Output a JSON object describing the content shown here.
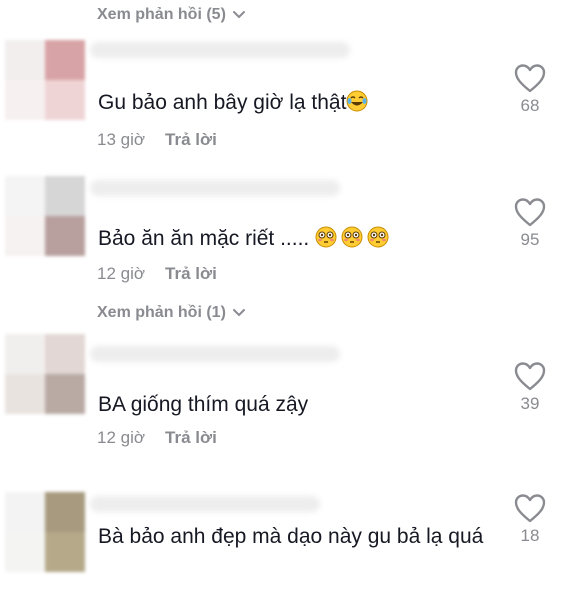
{
  "thread1": {
    "view_replies": "Xem phản hồi (5)"
  },
  "comments": [
    {
      "text": "Gu bảo anh bây giờ lạ thật",
      "emoji": "laughing-crying-emoji",
      "time": "13 giờ",
      "reply": "Trả lời",
      "likes": "68"
    },
    {
      "text": "Bảo ăn ăn mặc riết .....",
      "emoji": "flushed-face-emoji",
      "time": "12 giờ",
      "reply": "Trả lời",
      "likes": "95"
    },
    {
      "text": "BA giống thím quá zậy",
      "time": "12 giờ",
      "reply": "Trả lời",
      "likes": "39"
    },
    {
      "text": "Bà bảo anh đẹp mà dạo này gu bả lạ quá",
      "likes": "18"
    }
  ],
  "thread2": {
    "view_replies": "Xem phản hồi (1)"
  },
  "colors": {
    "text": "#161823",
    "muted": "#8a8b91",
    "like_outline": "#8a8b91"
  }
}
